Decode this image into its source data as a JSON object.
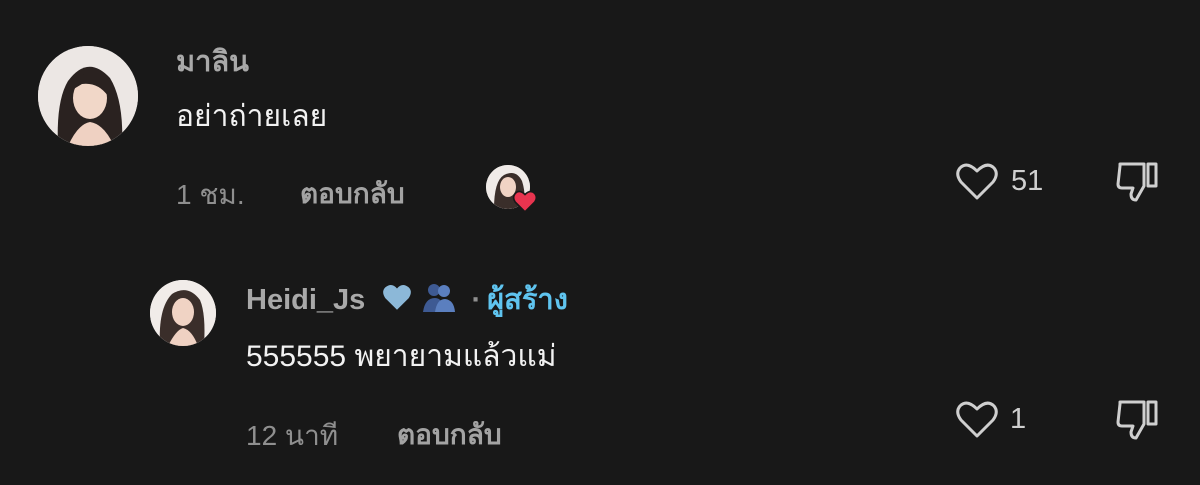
{
  "comments": [
    {
      "username": "มาลิน",
      "text": "อย่าถ่ายเลย",
      "time": "1 ชม.",
      "reply_label": "ตอบกลับ",
      "likes": "51"
    }
  ],
  "replies": [
    {
      "username": "Heidi_Js",
      "badges": [
        "blue-heart-emoji",
        "people-hugging-emoji"
      ],
      "separator": "·",
      "creator_label": "ผู้สร้าง",
      "text": "555555 พยายามแล้วแม่",
      "time": "12 นาที",
      "reply_label": "ตอบกลับ",
      "likes": "1"
    }
  ],
  "colors": {
    "background": "#181818",
    "creator": "#5fc4ef",
    "liked_by_creator_heart": "#e8344f"
  }
}
